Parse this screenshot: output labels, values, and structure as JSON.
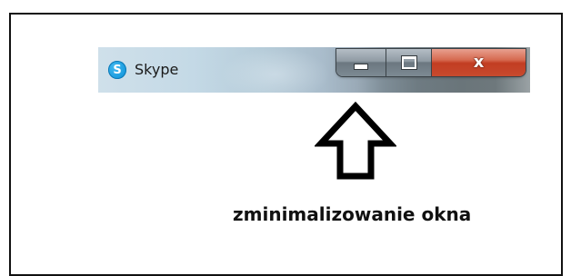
{
  "window": {
    "title": "Skype",
    "icon": "skype-icon",
    "icon_letter": "S",
    "accent_color": "#0a8ed6"
  },
  "controls": {
    "minimize_icon": "minimize-icon",
    "maximize_icon": "maximize-icon",
    "close_icon": "close-icon",
    "close_label": "x",
    "close_color": "#c23d22"
  },
  "annotation": {
    "arrow_icon": "up-arrow-icon",
    "caption": "zminimalizowanie okna"
  }
}
